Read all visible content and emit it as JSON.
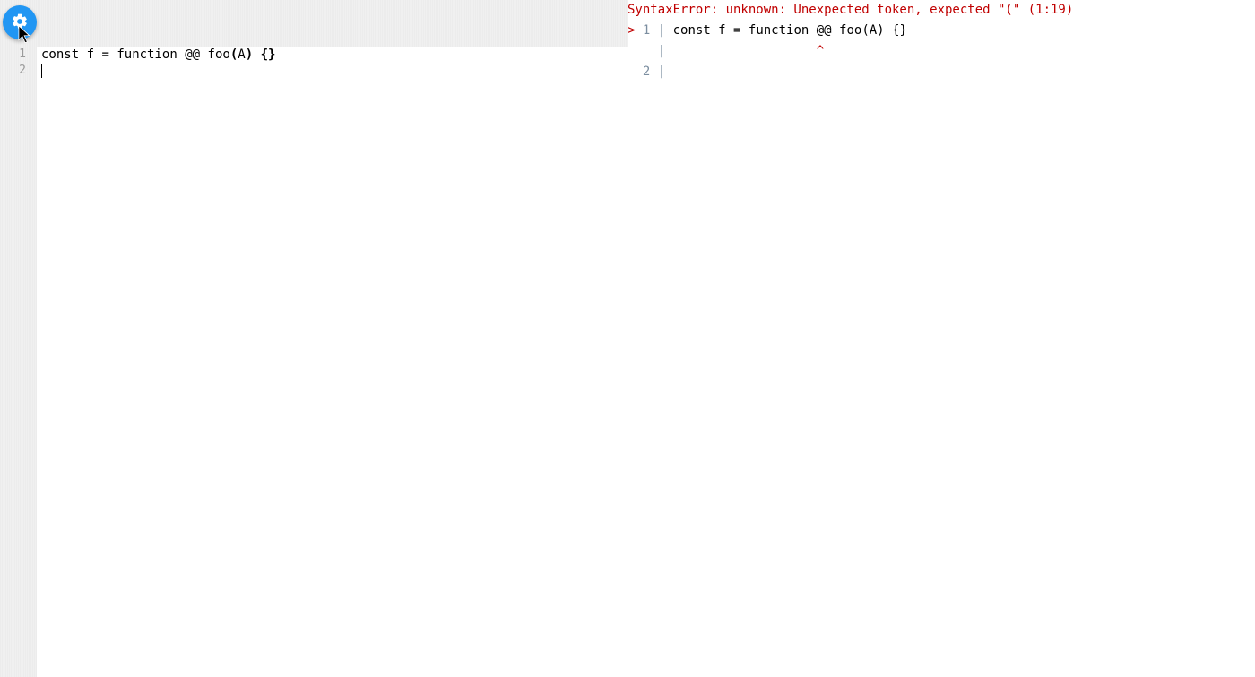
{
  "editor": {
    "line_numbers": [
      "1",
      "2"
    ],
    "active_line_index": 1,
    "tokens": {
      "l1_const": "const",
      "l1_sp1": " ",
      "l1_f": "f",
      "l1_sp2": " ",
      "l1_eq": "=",
      "l1_sp3": " ",
      "l1_function": "function",
      "l1_sp4": " ",
      "l1_atat": "@@",
      "l1_sp5": " ",
      "l1_foo": "foo",
      "l1_paren_open": "(",
      "l1_A": "A",
      "l1_paren_close": ")",
      "l1_sp6": " ",
      "l1_brace_open": "{",
      "l1_brace_close": "}"
    }
  },
  "output": {
    "error_header": "SyntaxError: unknown: Unexpected token, expected \"(\" (1:19)",
    "blank": "",
    "context": {
      "marker1": ">",
      "lineno1": " 1 ",
      "pipe": "|",
      "sp": " ",
      "code1": "const f = function @@ foo(A) {}",
      "caret_pad": "    |                    ",
      "caret": "^",
      "lineno2": "  2 ",
      "code2": ""
    }
  },
  "icons": {
    "settings": "gear-icon"
  }
}
